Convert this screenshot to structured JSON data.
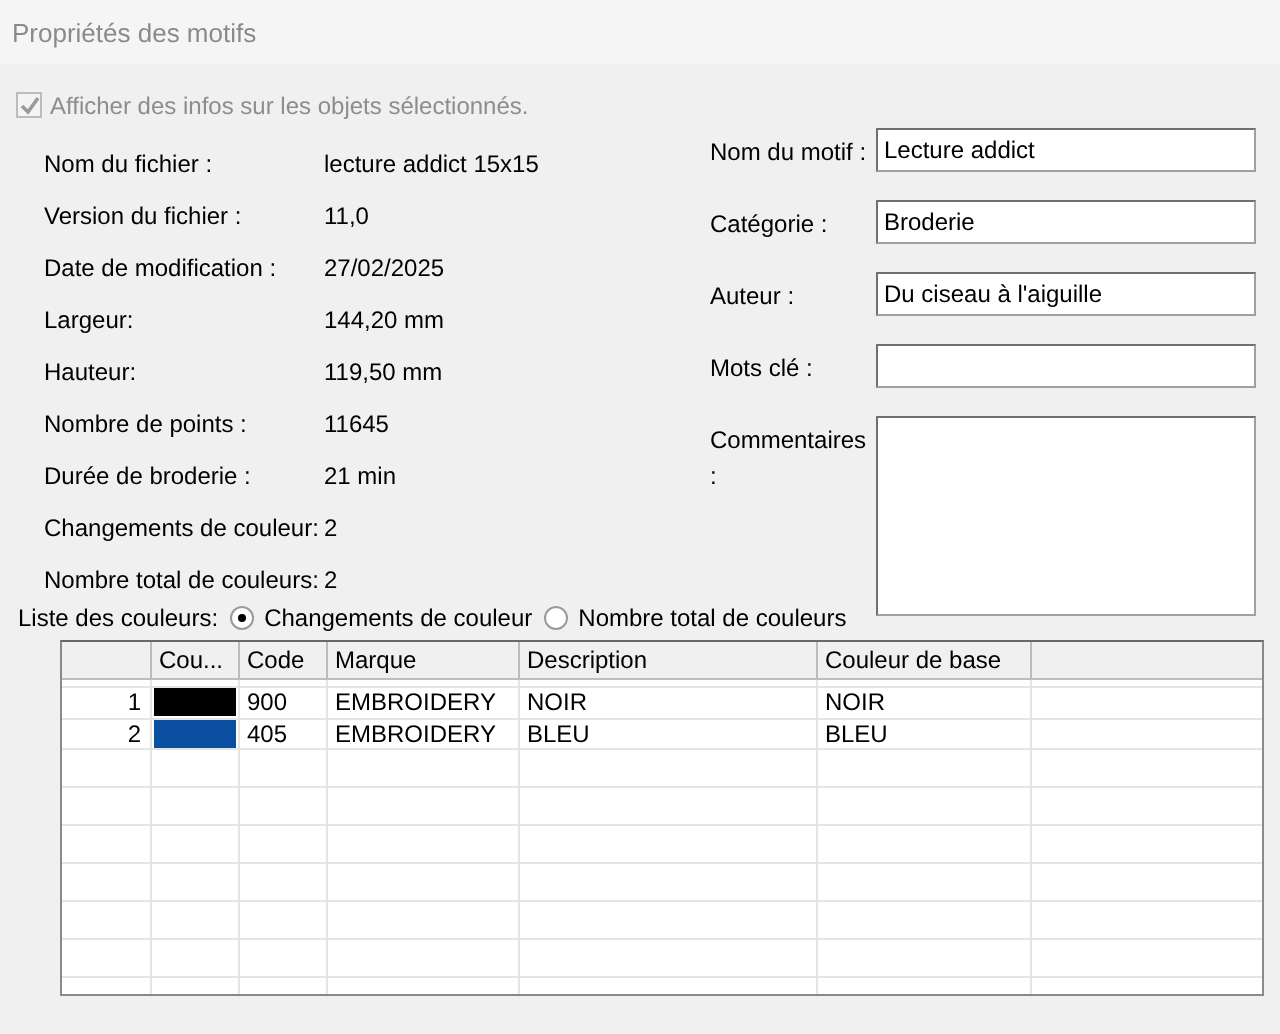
{
  "window": {
    "title": "Propriétés des motifs"
  },
  "show_info_checkbox": {
    "label": "Afficher des infos sur les objets sélectionnés.",
    "checked": true,
    "disabled": true
  },
  "info": [
    {
      "label": "Nom du fichier :",
      "value": "lecture addict 15x15"
    },
    {
      "label": "Version du fichier :",
      "value": "11,0"
    },
    {
      "label": "Date de modification :",
      "value": "27/02/2025"
    },
    {
      "label": "Largeur:",
      "value": "144,20 mm"
    },
    {
      "label": "Hauteur:",
      "value": "119,50 mm"
    },
    {
      "label": "Nombre de points :",
      "value": "11645"
    },
    {
      "label": "Durée de broderie :",
      "value": "21 min"
    },
    {
      "label": "Changements de couleur:",
      "value": "2"
    },
    {
      "label": "Nombre total de couleurs:",
      "value": "2"
    }
  ],
  "fields": [
    {
      "label": "Nom du motif :",
      "value": "Lecture addict",
      "kind": "text"
    },
    {
      "label": "Catégorie :",
      "value": "Broderie",
      "kind": "text"
    },
    {
      "label": "Auteur :",
      "value": "Du ciseau à l'aiguille",
      "kind": "text"
    },
    {
      "label": "Mots clé :",
      "kind": "text"
    },
    {
      "label": "Commentaires :",
      "kind": "multiline"
    }
  ],
  "color_list": {
    "label": "Liste des couleurs:",
    "options": [
      {
        "label": "Changements de couleur",
        "selected": true
      },
      {
        "label": "Nombre total de couleurs",
        "selected": false
      }
    ]
  },
  "table": {
    "columns": [
      "Cou...",
      "Code",
      "Marque",
      "Description",
      "Couleur de base"
    ],
    "rows": [
      {
        "index": "1",
        "color": "#000000",
        "code": "900",
        "brand": "EMBROIDERY",
        "description": "NOIR",
        "base_color": "NOIR"
      },
      {
        "index": "2",
        "color": "#0a4fa0",
        "code": "405",
        "brand": "EMBROIDERY",
        "description": "BLEU",
        "base_color": "BLEU"
      }
    ]
  }
}
